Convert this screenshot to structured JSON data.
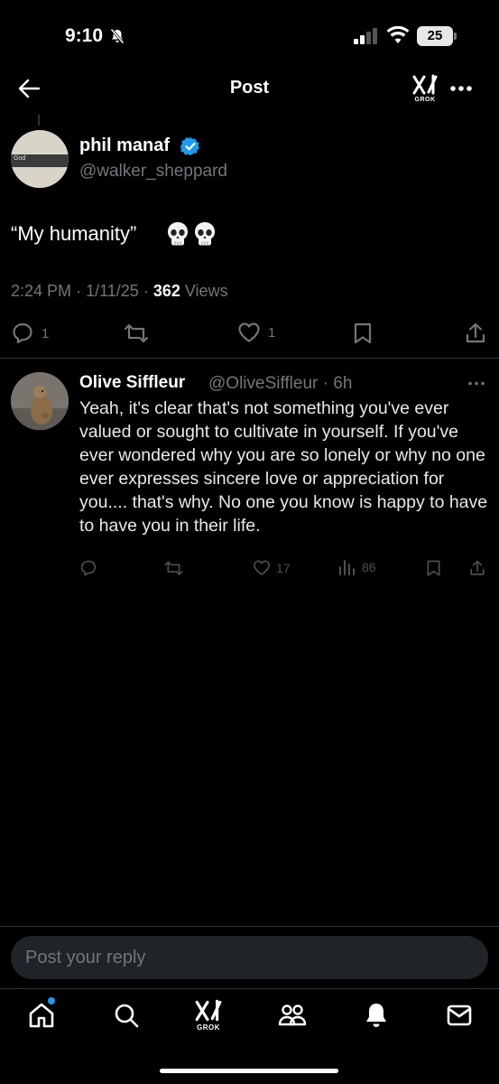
{
  "status_bar": {
    "time": "9:10",
    "battery": "25"
  },
  "header": {
    "title": "Post",
    "grok_label": "GROK"
  },
  "post": {
    "author_name": "phil manaf",
    "author_handle": "@walker_sheppard",
    "avatar_text": "God",
    "text": "“My humanity”",
    "time": "2:24 PM",
    "date": "1/11/25",
    "views_count": "362",
    "views_label": "Views",
    "replies": "1",
    "likes": "1"
  },
  "reply": {
    "author_name": "Olive Siffleur",
    "author_handle": "@OliveSiffleur",
    "age": "6h",
    "text": "Yeah, it's clear that's not something you've ever valued or sought to cultivate in yourself. If you've ever wondered why you are so lonely or why no one ever expresses sincere love or appreciation for you.... that's why. No one you know is happy to have to have you in their life.",
    "likes": "17",
    "views": "86"
  },
  "composer": {
    "placeholder": "Post your reply"
  },
  "nav": {
    "grok_label": "GROK"
  },
  "colors": {
    "accent": "#1d9bf0",
    "background": "#000000",
    "muted": "#71767b"
  }
}
